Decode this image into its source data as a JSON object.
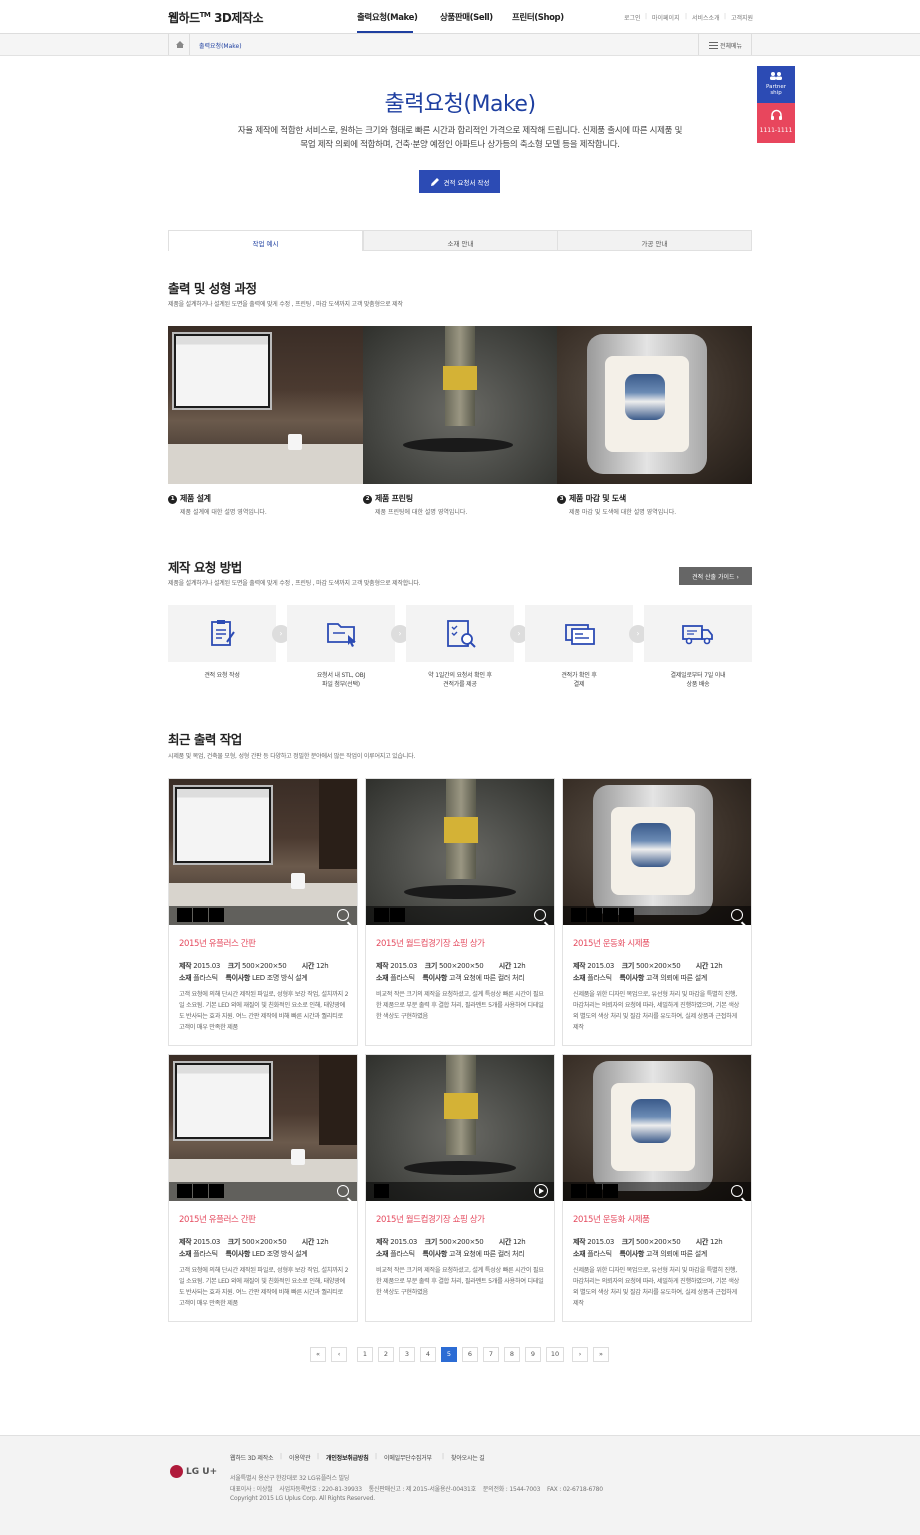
{
  "header": {
    "logo": "웹하드",
    "logo_tm": "TM",
    "logo_rest": "3D제작소",
    "nav": [
      "출력요청(Make)",
      "상품판매(Sell)",
      "프린터(Shop)"
    ],
    "util": [
      "로그인",
      "마이페이지",
      "서비스소개",
      "고객지원"
    ]
  },
  "breadcrumb": {
    "current": "출력요청(Make)",
    "all_menu": "전체메뉴"
  },
  "quick": {
    "partner": "Partner ship",
    "phone": "1111-1111"
  },
  "intro": {
    "title": "출력요청(Make)",
    "desc1": "자율 제작에 적합한 서비스로, 원하는 크기와 형태로 빠른 시간과 합리적인 가격으로 제작해 드립니다. 신제품 출시에 따른 시제품 및",
    "desc2": "목업 제작 의뢰에 적합하며, 건축·분양 예정인 아파트나 상가등의 축소형 모델 등을 제작합니다.",
    "button": "견적 요청서 작성"
  },
  "tabs": [
    "작업 예시",
    "소재 안내",
    "가공 안내"
  ],
  "process": {
    "title": "출력 및 성형 과정",
    "sub": "제품을 설계하거나 설계된 도면을 출력에 맞게 수정 , 프린팅 , 마감 도색까지 고객 맞춤형으로 제작",
    "steps": [
      {
        "num": "1",
        "title": "제품 설계",
        "desc": "제품 설계에 대한 설명 영역입니다."
      },
      {
        "num": "2",
        "title": "제품 프린팅",
        "desc": "제품 프린팅에 대한 설명 영역입니다."
      },
      {
        "num": "3",
        "title": "제품 마감 및 도색",
        "desc": "제품 마감 및 도색에 대한 설명 영역입니다."
      }
    ]
  },
  "howto": {
    "title": "제작 요청 방법",
    "sub": "제품을 설계하거나 설계된 도면을 출력에 맞게 수정 , 프린팅 , 마감 도색까지 고객 맞춤형으로 제작합니다.",
    "guide_button": "견적 산출 가이드",
    "steps": [
      {
        "l1": "견적 요청 작성",
        "l2": ""
      },
      {
        "l1": "요청서 내 STL, OBJ",
        "l2": "파일 첨부(선택)"
      },
      {
        "l1": "약 1일간의 요청서 확인 후",
        "l2": "견적가를 제공"
      },
      {
        "l1": "견적가 확인 후",
        "l2": "결제"
      },
      {
        "l1": "결제일로부터 7일 이내",
        "l2": "상품 배송"
      }
    ]
  },
  "recent": {
    "title": "최근 출력 작업",
    "sub": "시제품 및 목업, 건축물 모형, 성형 간판 등 다양하고 정밀한 분야에서 많은 작업이 이루어지고 있습니다.",
    "labels": {
      "make": "제작",
      "size": "크기",
      "time": "시간",
      "material": "소재",
      "note": "특이사항"
    },
    "cards": [
      {
        "title": "2015년 유플러스 간판",
        "make": "2015.03",
        "size": "500×200×50",
        "time": "12h",
        "material": "플라스틱",
        "note": "LED 조명 방식 설계",
        "desc": "고객 요청에 의해 단시간 제작된 파일로, 성형후 보강 작업, 설치까지 2일 소요됨. 기본 LED 외에 재질이 빛 친화적인 요소로 인해, 태양광에도 반사되는 효과 지원. 여느 간판 제작에 비해 빠른 시간과 퀄리티로 고객이 매우 만족한 제품"
      },
      {
        "title": "2015년 월드컵경기장 쇼핑 상가",
        "make": "2015.03",
        "size": "500×200×50",
        "time": "12h",
        "material": "플라스틱",
        "note": "고객 요청에 따른 컬러 처리",
        "desc": "비교적 작은 크기의 제작을 요청하셨고, 설계 특성상 빠른 시간이 필요한 제품으로 부분 출력 후 결합 처리, 필라멘트 5개를 사용하여 디테일한 색상도 구현하였음"
      },
      {
        "title": "2015년 운동화 시제품",
        "make": "2015.03",
        "size": "500×200×50",
        "time": "12h",
        "material": "플라스틱",
        "note": "고객 의뢰에 따른 설계",
        "desc": "신제품을 위한 디자인 목업으로, 유선형 처리 및 마감을 특별히 진행, 마감처리는 의뢰자의 요청에 따라, 세밀하게 진행하였으며, 기본 색상 외 별도의 색상 처리 및 질감 처리를 유도하여, 실제 상품과 근접하게 제작"
      },
      {
        "title": "2015년 유플러스 간판",
        "make": "2015.03",
        "size": "500×200×50",
        "time": "12h",
        "material": "플라스틱",
        "note": "LED 조명 방식 설계",
        "desc": "고객 요청에 의해 단시간 제작된 파일로, 성형후 보강 작업, 설치까지 2일 소요됨. 기본 LED 외에 재질이 빛 친화적인 요소로 인해, 태양광에도 반사되는 효과 지원. 여느 간판 제작에 비해 빠른 시간과 퀄리티로 고객이 매우 만족한 제품"
      },
      {
        "title": "2015년 월드컵경기장 쇼핑 상가",
        "make": "2015.03",
        "size": "500×200×50",
        "time": "12h",
        "material": "플라스틱",
        "note": "고객 요청에 따른 컬러 처리",
        "desc": "비교적 작은 크기의 제작을 요청하셨고, 설계 특성상 빠른 시간이 필요한 제품으로 부분 출력 후 결합 처리, 필라멘트 5개를 사용하여 디테일한 색상도 구현하였음"
      },
      {
        "title": "2015년 운동화 시제품",
        "make": "2015.03",
        "size": "500×200×50",
        "time": "12h",
        "material": "플라스틱",
        "note": "고객 의뢰에 따른 설계",
        "desc": "신제품을 위한 디자인 목업으로, 유선형 처리 및 마감을 특별히 진행, 마감처리는 의뢰자의 요청에 따라, 세밀하게 진행하였으며, 기본 색상 외 별도의 색상 처리 및 질감 처리를 유도하여, 실제 상품과 근접하게 제작"
      }
    ]
  },
  "pagination": {
    "first": "«",
    "prev": "‹",
    "pages": [
      "1",
      "2",
      "3",
      "4",
      "5",
      "6",
      "7",
      "8",
      "9",
      "10"
    ],
    "current": "5",
    "next": "›",
    "last": "»"
  },
  "footer": {
    "links": [
      "웹하드 3D 제작소",
      "이용약관",
      "개인정보취급방침",
      "이메일무단수집거부",
      "찾아오시는 길"
    ],
    "logo": "LG U+",
    "address": "서울특별시 용산구 한강대로 32 LG유플러스 빌딩",
    "info": "대표이사 : 이상철    사업자등록번호 : 220-81-39933    통신판매신고 : 제 2015-서울용산-00431호    문의전화 : 1544-7003    FAX : 02-6718-6780",
    "copyright": "Copyright 2015 LG Uplus Corp. All Rights Reserved."
  },
  "colors": {
    "primary": "#2c4bb4",
    "accent_red": "#e54b5f",
    "title_blue": "#1e3fa0"
  }
}
